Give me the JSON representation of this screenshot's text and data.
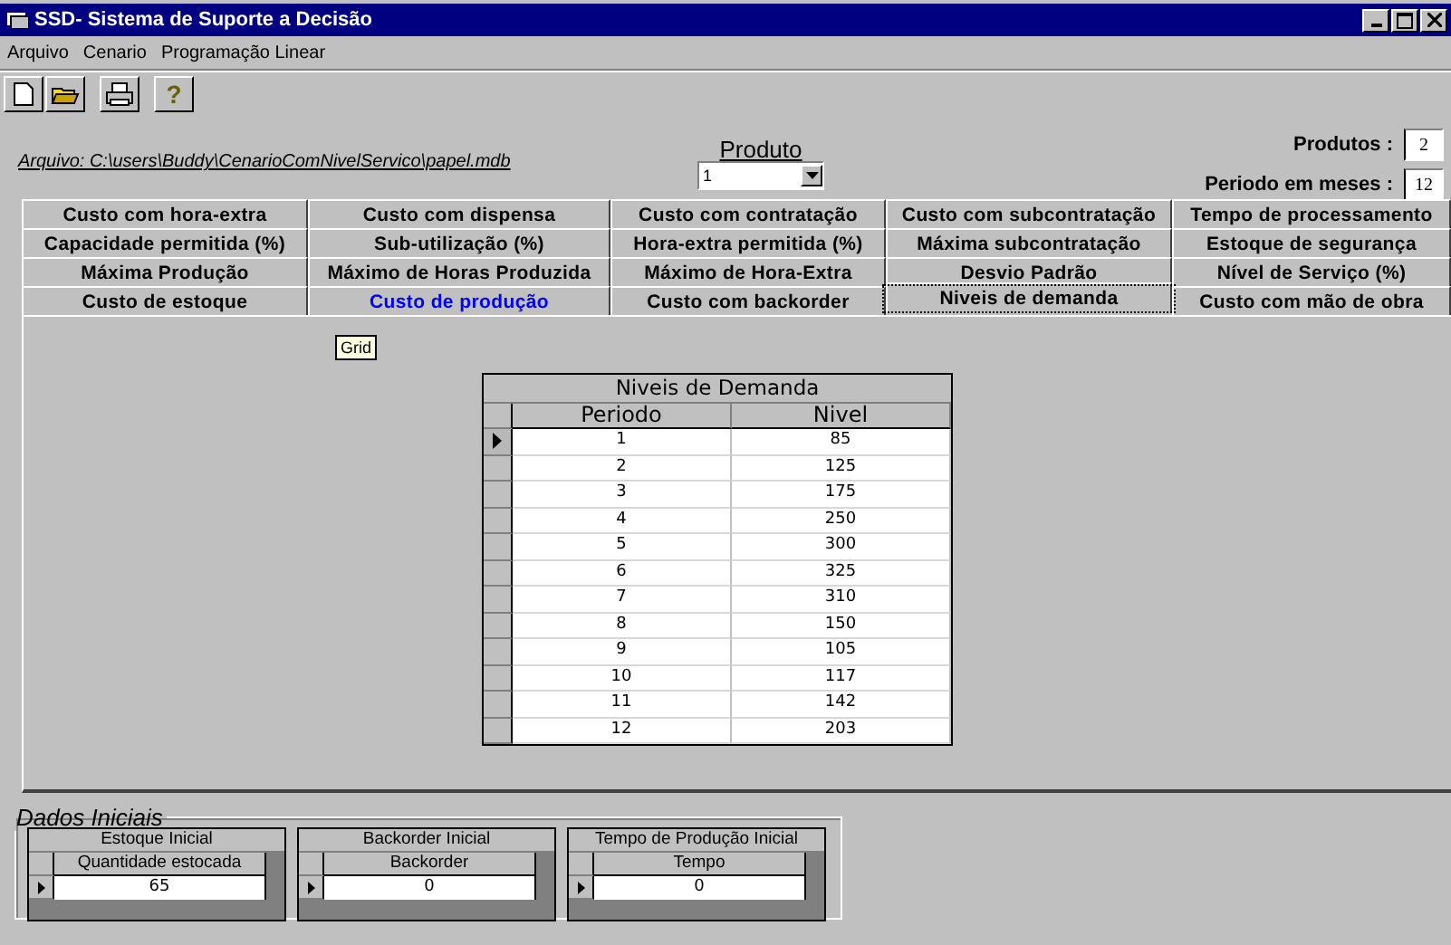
{
  "window": {
    "title": "SSD- Sistema de Suporte a Decisão"
  },
  "menu": [
    "Arquivo",
    "Cenario",
    "Programação Linear"
  ],
  "help_button": "?",
  "file_path": "Arquivo:  C:\\users\\Buddy\\CenarioComNivelServico\\papel.mdb",
  "produto": {
    "label": "Produto",
    "value": "1"
  },
  "produtos": {
    "label": "Produtos :",
    "value": "2"
  },
  "periodo": {
    "label": "Periodo em meses :",
    "value": "12"
  },
  "tab_rows": [
    [
      {
        "label": "Custo com hora-extra",
        "selected": false,
        "highlighted": false
      },
      {
        "label": "Custo com dispensa",
        "selected": false,
        "highlighted": false
      },
      {
        "label": "Custo com contratação",
        "selected": false,
        "highlighted": false
      },
      {
        "label": "Custo com subcontratação",
        "selected": false,
        "highlighted": false
      },
      {
        "label": "Tempo de processamento",
        "selected": false,
        "highlighted": false
      }
    ],
    [
      {
        "label": "Capacidade permitida (%)",
        "selected": false,
        "highlighted": false
      },
      {
        "label": "Sub-utilização (%)",
        "selected": false,
        "highlighted": false
      },
      {
        "label": "Hora-extra permitida (%)",
        "selected": false,
        "highlighted": false
      },
      {
        "label": "Máxima subcontratação",
        "selected": false,
        "highlighted": false
      },
      {
        "label": "Estoque de segurança",
        "selected": false,
        "highlighted": false
      }
    ],
    [
      {
        "label": "Máxima Produção",
        "selected": false,
        "highlighted": false
      },
      {
        "label": "Máximo de Horas Produzida",
        "selected": false,
        "highlighted": false
      },
      {
        "label": "Máximo de Hora-Extra",
        "selected": false,
        "highlighted": false
      },
      {
        "label": "Desvio Padrão",
        "selected": false,
        "highlighted": false
      },
      {
        "label": "Nível de Serviço (%)",
        "selected": false,
        "highlighted": false
      }
    ],
    [
      {
        "label": "Custo de estoque",
        "selected": false,
        "highlighted": false
      },
      {
        "label": "Custo de produção",
        "selected": false,
        "highlighted": true
      },
      {
        "label": "Custo com backorder",
        "selected": false,
        "highlighted": false
      },
      {
        "label": "Niveis de demanda",
        "selected": true,
        "highlighted": false
      },
      {
        "label": "Custo com mão de obra",
        "selected": false,
        "highlighted": false
      }
    ]
  ],
  "tooltip": "Grid",
  "demand_grid": {
    "caption": "Niveis de Demanda",
    "columns": [
      "Periodo",
      "Nivel"
    ],
    "rows": [
      {
        "cells": [
          "1",
          "85"
        ],
        "current": true
      },
      {
        "cells": [
          "2",
          "125"
        ],
        "current": false
      },
      {
        "cells": [
          "3",
          "175"
        ],
        "current": false
      },
      {
        "cells": [
          "4",
          "250"
        ],
        "current": false
      },
      {
        "cells": [
          "5",
          "300"
        ],
        "current": false
      },
      {
        "cells": [
          "6",
          "325"
        ],
        "current": false
      },
      {
        "cells": [
          "7",
          "310"
        ],
        "current": false
      },
      {
        "cells": [
          "8",
          "150"
        ],
        "current": false
      },
      {
        "cells": [
          "9",
          "105"
        ],
        "current": false
      },
      {
        "cells": [
          "10",
          "117"
        ],
        "current": false
      },
      {
        "cells": [
          "11",
          "142"
        ],
        "current": false
      },
      {
        "cells": [
          "12",
          "203"
        ],
        "current": false
      }
    ]
  },
  "initial_data": {
    "title": "Dados Iniciais",
    "grids": [
      {
        "caption": "Estoque Inicial",
        "column": "Quantidade estocada",
        "value": "65",
        "current": true
      },
      {
        "caption": "Backorder Inicial",
        "column": "Backorder",
        "value": "0",
        "current": true
      },
      {
        "caption": "Tempo de Produção Inicial",
        "column": "Tempo",
        "value": "0",
        "current": true
      }
    ]
  }
}
